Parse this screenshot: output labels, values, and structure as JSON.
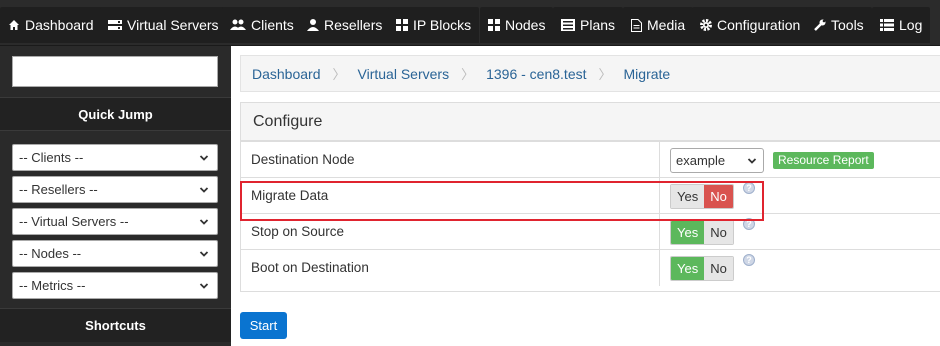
{
  "nav": {
    "tabs": [
      {
        "label": "Dashboard",
        "icon": "home-icon"
      },
      {
        "label": "Virtual Servers",
        "icon": "server-icon"
      },
      {
        "label": "Clients",
        "icon": "users-icon"
      },
      {
        "label": "Resellers",
        "icon": "user-icon"
      },
      {
        "label": "IP Blocks",
        "icon": "grid-icon"
      },
      {
        "label": "Nodes",
        "icon": "grid-icon"
      },
      {
        "label": "Plans",
        "icon": "list-icon"
      },
      {
        "label": "Media",
        "icon": "file-icon"
      },
      {
        "label": "Configuration",
        "icon": "gear-icon"
      },
      {
        "label": "Tools",
        "icon": "wrench-icon"
      },
      {
        "label": "Log",
        "icon": "list-icon"
      }
    ]
  },
  "sidebar": {
    "search_value": "",
    "quick_jump_title": "Quick Jump",
    "selects": [
      "-- Clients --",
      "-- Resellers --",
      "-- Virtual Servers --",
      "-- Nodes --",
      "-- Metrics --"
    ],
    "shortcuts_title": "Shortcuts"
  },
  "breadcrumb": {
    "items": [
      "Dashboard",
      "Virtual Servers",
      "1396 - cen8.test",
      "Migrate"
    ],
    "separator": "〉"
  },
  "panel": {
    "title": "Configure",
    "destination_node": {
      "label": "Destination Node",
      "value": "example",
      "button": "Resource Report"
    },
    "migrate_data": {
      "label": "Migrate Data",
      "yes": "Yes",
      "no": "No",
      "selected": "No"
    },
    "stop_on_source": {
      "label": "Stop on Source",
      "yes": "Yes",
      "no": "No",
      "selected": "Yes"
    },
    "boot_on_destination": {
      "label": "Boot on Destination",
      "yes": "Yes",
      "no": "No",
      "selected": "Yes"
    }
  },
  "start_button": "Start",
  "colors": {
    "green": "#5cb85c",
    "red": "#d9534f",
    "primary": "#0a74d0",
    "highlight": "#e0242f"
  }
}
